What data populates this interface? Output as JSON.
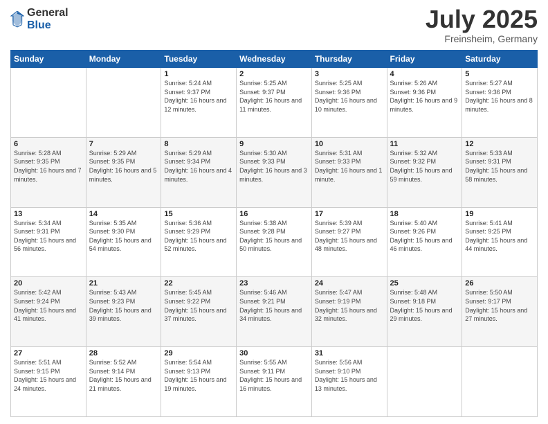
{
  "logo": {
    "general": "General",
    "blue": "Blue"
  },
  "header": {
    "month": "July 2025",
    "location": "Freinsheim, Germany"
  },
  "weekdays": [
    "Sunday",
    "Monday",
    "Tuesday",
    "Wednesday",
    "Thursday",
    "Friday",
    "Saturday"
  ],
  "weeks": [
    [
      {
        "day": "",
        "info": ""
      },
      {
        "day": "",
        "info": ""
      },
      {
        "day": "1",
        "info": "Sunrise: 5:24 AM\nSunset: 9:37 PM\nDaylight: 16 hours and 12 minutes."
      },
      {
        "day": "2",
        "info": "Sunrise: 5:25 AM\nSunset: 9:37 PM\nDaylight: 16 hours and 11 minutes."
      },
      {
        "day": "3",
        "info": "Sunrise: 5:25 AM\nSunset: 9:36 PM\nDaylight: 16 hours and 10 minutes."
      },
      {
        "day": "4",
        "info": "Sunrise: 5:26 AM\nSunset: 9:36 PM\nDaylight: 16 hours and 9 minutes."
      },
      {
        "day": "5",
        "info": "Sunrise: 5:27 AM\nSunset: 9:36 PM\nDaylight: 16 hours and 8 minutes."
      }
    ],
    [
      {
        "day": "6",
        "info": "Sunrise: 5:28 AM\nSunset: 9:35 PM\nDaylight: 16 hours and 7 minutes."
      },
      {
        "day": "7",
        "info": "Sunrise: 5:29 AM\nSunset: 9:35 PM\nDaylight: 16 hours and 5 minutes."
      },
      {
        "day": "8",
        "info": "Sunrise: 5:29 AM\nSunset: 9:34 PM\nDaylight: 16 hours and 4 minutes."
      },
      {
        "day": "9",
        "info": "Sunrise: 5:30 AM\nSunset: 9:33 PM\nDaylight: 16 hours and 3 minutes."
      },
      {
        "day": "10",
        "info": "Sunrise: 5:31 AM\nSunset: 9:33 PM\nDaylight: 16 hours and 1 minute."
      },
      {
        "day": "11",
        "info": "Sunrise: 5:32 AM\nSunset: 9:32 PM\nDaylight: 15 hours and 59 minutes."
      },
      {
        "day": "12",
        "info": "Sunrise: 5:33 AM\nSunset: 9:31 PM\nDaylight: 15 hours and 58 minutes."
      }
    ],
    [
      {
        "day": "13",
        "info": "Sunrise: 5:34 AM\nSunset: 9:31 PM\nDaylight: 15 hours and 56 minutes."
      },
      {
        "day": "14",
        "info": "Sunrise: 5:35 AM\nSunset: 9:30 PM\nDaylight: 15 hours and 54 minutes."
      },
      {
        "day": "15",
        "info": "Sunrise: 5:36 AM\nSunset: 9:29 PM\nDaylight: 15 hours and 52 minutes."
      },
      {
        "day": "16",
        "info": "Sunrise: 5:38 AM\nSunset: 9:28 PM\nDaylight: 15 hours and 50 minutes."
      },
      {
        "day": "17",
        "info": "Sunrise: 5:39 AM\nSunset: 9:27 PM\nDaylight: 15 hours and 48 minutes."
      },
      {
        "day": "18",
        "info": "Sunrise: 5:40 AM\nSunset: 9:26 PM\nDaylight: 15 hours and 46 minutes."
      },
      {
        "day": "19",
        "info": "Sunrise: 5:41 AM\nSunset: 9:25 PM\nDaylight: 15 hours and 44 minutes."
      }
    ],
    [
      {
        "day": "20",
        "info": "Sunrise: 5:42 AM\nSunset: 9:24 PM\nDaylight: 15 hours and 41 minutes."
      },
      {
        "day": "21",
        "info": "Sunrise: 5:43 AM\nSunset: 9:23 PM\nDaylight: 15 hours and 39 minutes."
      },
      {
        "day": "22",
        "info": "Sunrise: 5:45 AM\nSunset: 9:22 PM\nDaylight: 15 hours and 37 minutes."
      },
      {
        "day": "23",
        "info": "Sunrise: 5:46 AM\nSunset: 9:21 PM\nDaylight: 15 hours and 34 minutes."
      },
      {
        "day": "24",
        "info": "Sunrise: 5:47 AM\nSunset: 9:19 PM\nDaylight: 15 hours and 32 minutes."
      },
      {
        "day": "25",
        "info": "Sunrise: 5:48 AM\nSunset: 9:18 PM\nDaylight: 15 hours and 29 minutes."
      },
      {
        "day": "26",
        "info": "Sunrise: 5:50 AM\nSunset: 9:17 PM\nDaylight: 15 hours and 27 minutes."
      }
    ],
    [
      {
        "day": "27",
        "info": "Sunrise: 5:51 AM\nSunset: 9:15 PM\nDaylight: 15 hours and 24 minutes."
      },
      {
        "day": "28",
        "info": "Sunrise: 5:52 AM\nSunset: 9:14 PM\nDaylight: 15 hours and 21 minutes."
      },
      {
        "day": "29",
        "info": "Sunrise: 5:54 AM\nSunset: 9:13 PM\nDaylight: 15 hours and 19 minutes."
      },
      {
        "day": "30",
        "info": "Sunrise: 5:55 AM\nSunset: 9:11 PM\nDaylight: 15 hours and 16 minutes."
      },
      {
        "day": "31",
        "info": "Sunrise: 5:56 AM\nSunset: 9:10 PM\nDaylight: 15 hours and 13 minutes."
      },
      {
        "day": "",
        "info": ""
      },
      {
        "day": "",
        "info": ""
      }
    ]
  ]
}
